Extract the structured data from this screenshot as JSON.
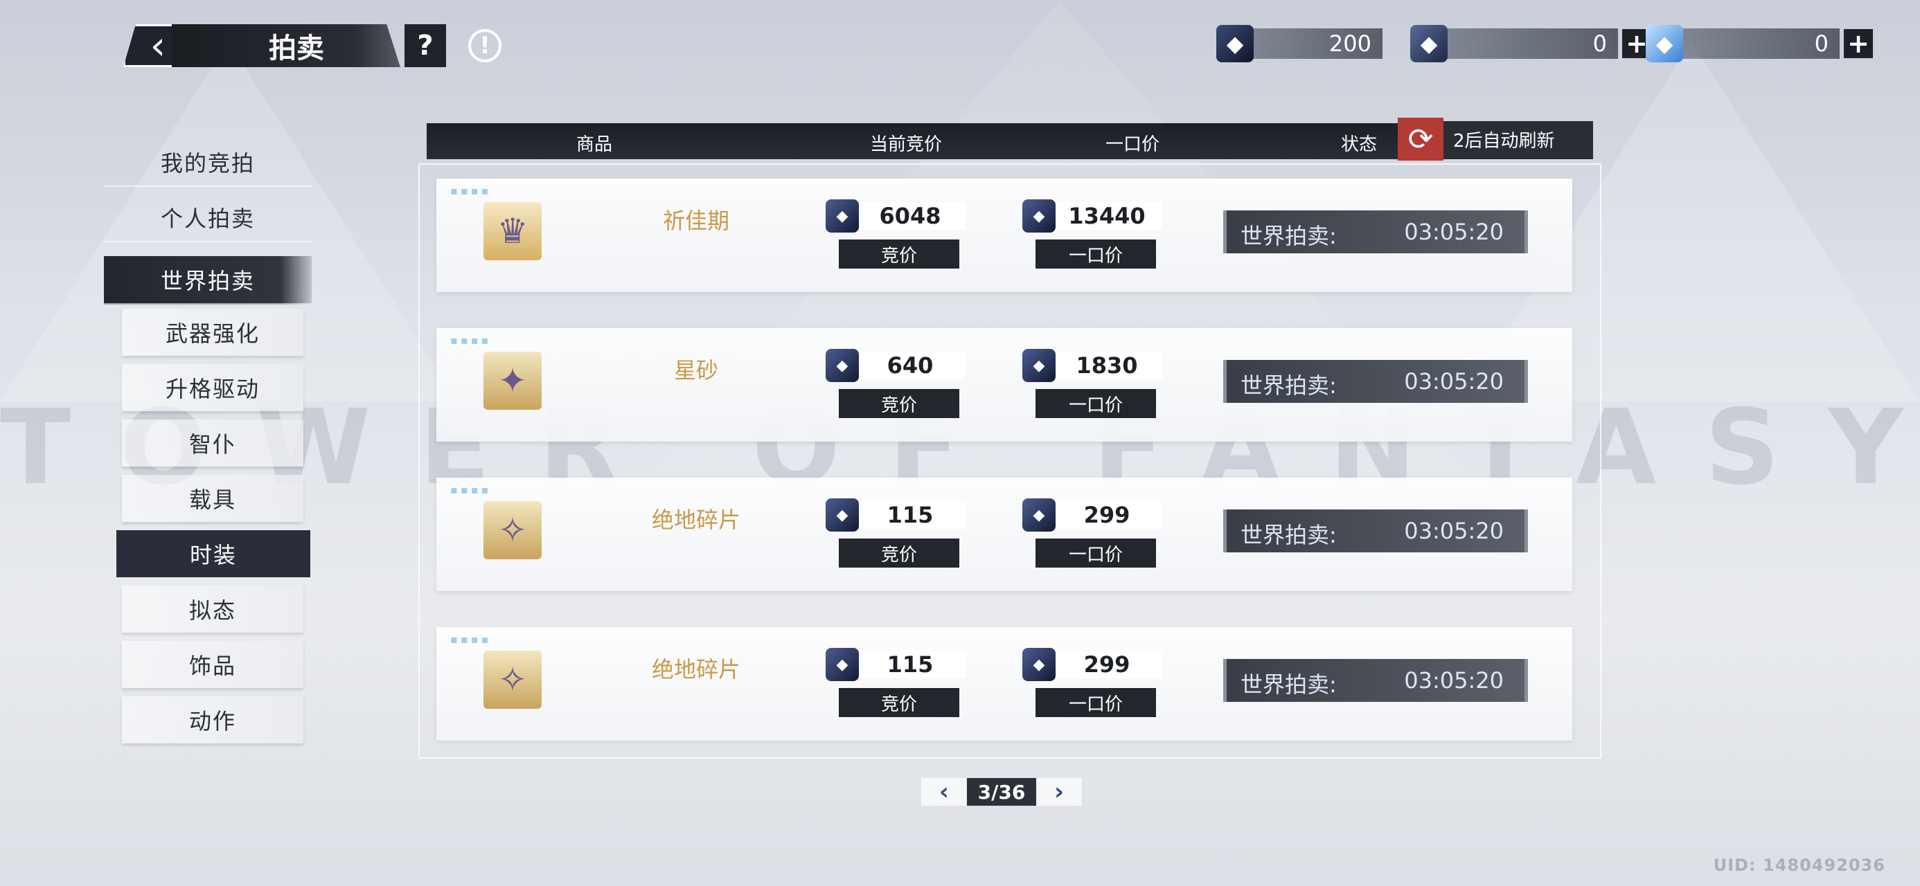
{
  "background_watermark": "TOWER OF FANTASY",
  "header": {
    "back_icon": "back-arrow-icon",
    "title": "拍卖",
    "help_label": "?",
    "info_label": "!"
  },
  "currencies": [
    {
      "icon": "dark-crystal-icon",
      "value": "200"
    },
    {
      "icon": "bag-crystal-icon",
      "value": "0",
      "plus": "+"
    },
    {
      "icon": "blue-crystal-icon",
      "value": "0",
      "plus": "+"
    }
  ],
  "sidebar": {
    "tabs": [
      {
        "label": "我的竞拍",
        "active": false
      },
      {
        "label": "个人拍卖",
        "active": false
      },
      {
        "label": "世界拍卖",
        "active": true
      }
    ],
    "categories": [
      {
        "label": "武器强化",
        "active": false
      },
      {
        "label": "升格驱动",
        "active": false
      },
      {
        "label": "智仆",
        "active": false
      },
      {
        "label": "载具",
        "active": false
      },
      {
        "label": "时装",
        "active": true
      },
      {
        "label": "拟态",
        "active": false
      },
      {
        "label": "饰品",
        "active": false
      },
      {
        "label": "动作",
        "active": false
      }
    ]
  },
  "table": {
    "columns": {
      "item": "商品",
      "current_bid": "当前竞价",
      "buyout": "一口价",
      "status": "状态"
    },
    "refresh_text": "2后自动刷新",
    "bid_button": "竞价",
    "buyout_button": "一口价",
    "rows": [
      {
        "name": "祈佳期",
        "current_bid": "6048",
        "buyout": "13440",
        "status_label": "世界拍卖:",
        "time": "03:05:20"
      },
      {
        "name": "星砂",
        "current_bid": "640",
        "buyout": "1830",
        "status_label": "世界拍卖:",
        "time": "03:05:20"
      },
      {
        "name": "绝地碎片",
        "current_bid": "115",
        "buyout": "299",
        "status_label": "世界拍卖:",
        "time": "03:05:20"
      },
      {
        "name": "绝地碎片",
        "current_bid": "115",
        "buyout": "299",
        "status_label": "世界拍卖:",
        "time": "03:05:20"
      }
    ]
  },
  "pager": {
    "prev": "‹",
    "page": "3/36",
    "next": "›"
  },
  "uid": "UID: 1480492036",
  "colors": {
    "accent_gold": "#c99a48",
    "refresh_red": "#b33a35",
    "dark_panel": "#23262d"
  }
}
